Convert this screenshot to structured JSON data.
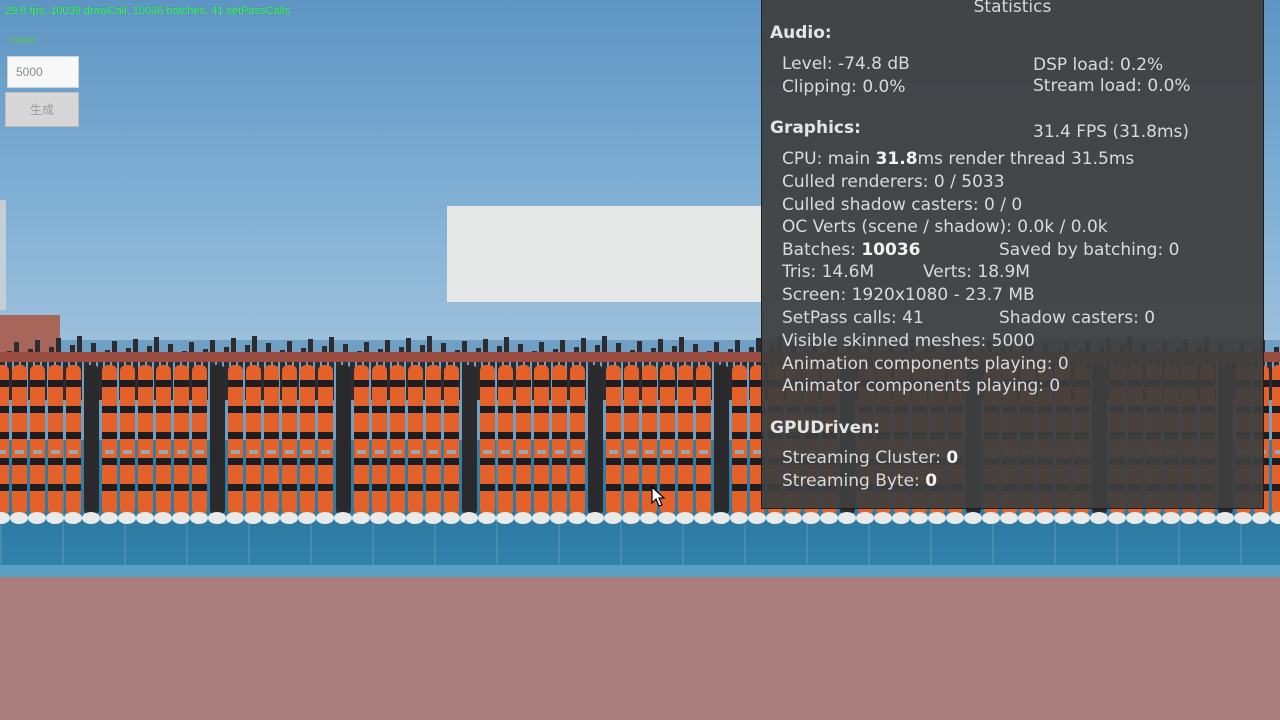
{
  "overlay": {
    "fps_text": "29.8 fps, 10039 drawCall, 10036 batches, 41 setPassCalls",
    "count_label": "Count:",
    "count_value": "5000",
    "generate_label": "生成"
  },
  "stats": {
    "title": "Statistics",
    "audio": {
      "header": "Audio:",
      "level": "Level: -74.8 dB",
      "dsp_load": "DSP load: 0.2%",
      "clipping": "Clipping: 0.0%",
      "stream_load": "Stream load: 0.0%"
    },
    "graphics": {
      "header": "Graphics:",
      "fps": "31.4 FPS (31.8ms)",
      "cpu_prefix": "CPU: main ",
      "cpu_main": "31.8",
      "cpu_suffix": "ms  render thread 31.5ms",
      "culled_renderers": "Culled renderers: 0 / 5033",
      "culled_shadow": "Culled shadow casters: 0 / 0",
      "oc_verts": "OC Verts (scene / shadow): 0.0k / 0.0k",
      "batches_label": "Batches: ",
      "batches_value": "10036",
      "saved_by_batching": "Saved by batching: 0",
      "tris": "Tris: 14.6M",
      "verts": "Verts: 18.9M",
      "screen": "Screen: 1920x1080 - 23.7 MB",
      "setpass": "SetPass calls: 41",
      "shadow_casters": "Shadow casters: 0",
      "skinned_meshes": "Visible skinned meshes: 5000",
      "animation_components": "Animation components playing: 0",
      "animator_components": "Animator components playing: 0"
    },
    "gpudriven": {
      "header": "GPUDriven:",
      "cluster_label": "Streaming Cluster: ",
      "cluster_value": "0",
      "byte_label": "Streaming Byte: ",
      "byte_value": "0"
    }
  },
  "colors": {
    "fps_text": "#33ff55",
    "panel_bg": "#3e3e3e",
    "floor": "#2e7aa3",
    "bottom_plane": "#ac7f7f",
    "character_orange": "#e4612a",
    "character_dark": "#2a2a2d"
  },
  "icons": {
    "cursor": "mouse-pointer-icon"
  }
}
